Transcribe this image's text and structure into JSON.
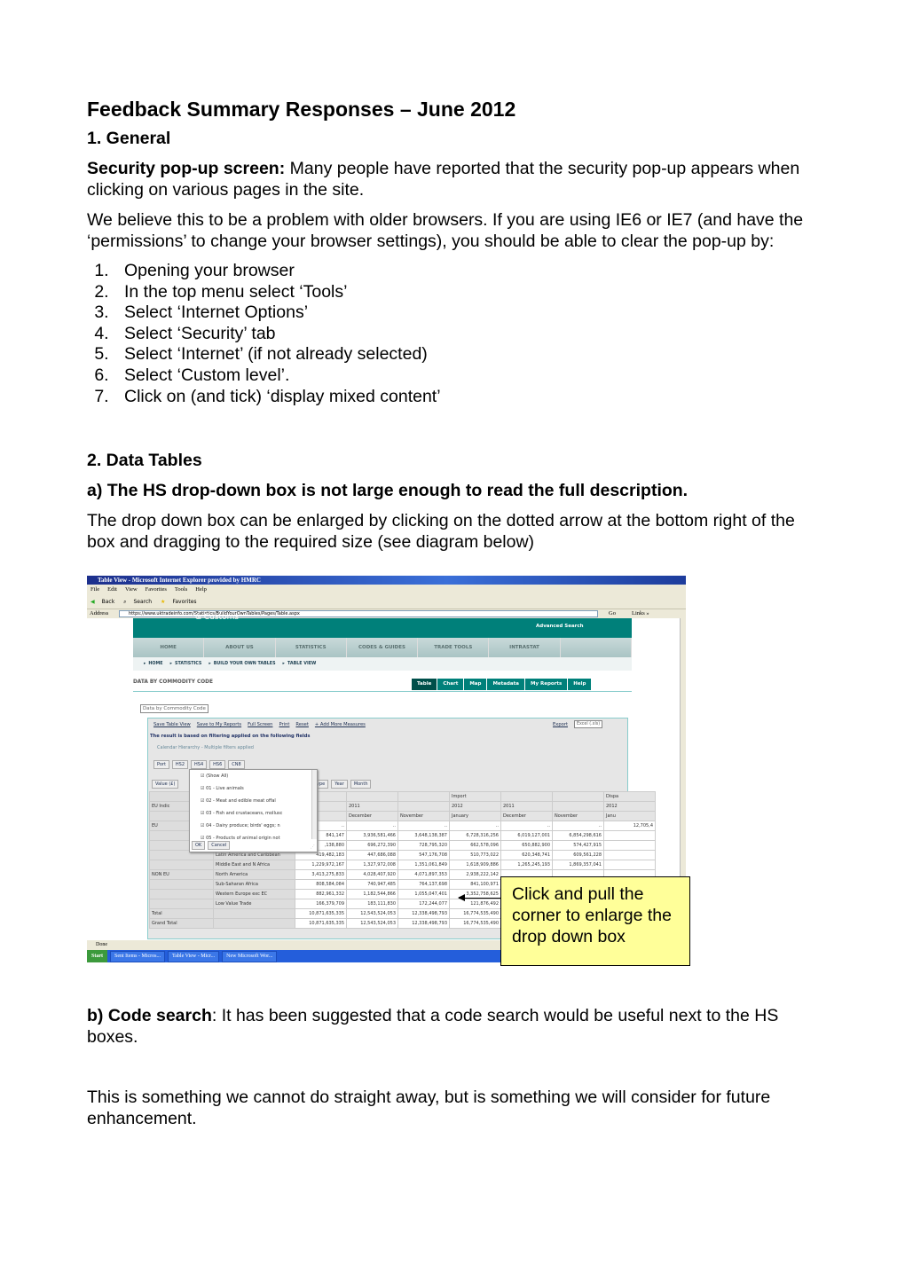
{
  "doc": {
    "title": "Feedback Summary Responses – June 2012",
    "s1_heading": "1. General",
    "p1_bold": "Security pop-up screen:",
    "p1_text": "  Many people have reported that the security pop-up appears when clicking on various pages in the site.",
    "p2": "We believe this to be a problem with older browsers. If you are using IE6 or IE7 (and have the ‘permissions’ to change your browser settings), you should be able to clear the pop-up by:",
    "steps": [
      "Opening your browser",
      "In the top menu select ‘Tools’",
      "Select ‘Internet Options’",
      "Select ‘Security’ tab",
      "Select ‘Internet’ (if not already selected)",
      "Select ‘Custom level’.",
      "Click on (and tick) ‘display mixed content’"
    ],
    "s2_heading": "2. Data Tables",
    "a_heading": "a) The HS drop-down box is not large enough to read the full description.",
    "a_text": "The drop down box can be enlarged by clicking on the dotted arrow at the bottom right of the box and dragging to the required size (see diagram below)",
    "b_bold": "b) Code search",
    "b_text": ":  It has been suggested that a code search would be useful next to the HS boxes.",
    "b_text2": "This is something we cannot do straight away, but is something we will consider for future enhancement."
  },
  "callout": "Click and pull the corner to enlarge the drop down box",
  "screenshot": {
    "window_title": "Table View - Microsoft Internet Explorer provided by HMRC",
    "menu": [
      "File",
      "Edit",
      "View",
      "Favorites",
      "Tools",
      "Help"
    ],
    "toolbar": [
      "Back",
      "Search",
      "Favorites"
    ],
    "address_label": "Address",
    "url": "https://www.uktradeinfo.com/Statistics/BuildYourOwnTables/Pages/Table.aspx",
    "go": "Go",
    "links": "Links »",
    "banner_logo": "& Customs",
    "advanced_search": "Advanced Search",
    "nav": [
      "HOME",
      "ABOUT US",
      "STATISTICS",
      "CODES & GUIDES",
      "TRADE TOOLS",
      "INTRASTAT",
      ""
    ],
    "breadcrumb": [
      "HOME",
      "STATISTICS",
      "BUILD YOUR OWN TABLES",
      "TABLE VIEW"
    ],
    "section_title": "DATA BY COMMODITY CODE",
    "tabs": [
      "Table",
      "Chart",
      "Map",
      "Metadata",
      "My Reports",
      "Help"
    ],
    "dataset_select": "Data by Commodity Code",
    "panel_actions": [
      "Save Table View",
      "Save to My Reports",
      "Full Screen",
      "Print",
      "Reset",
      "+ Add More Measures"
    ],
    "export": "Export",
    "export_format": "Excel (.xls)",
    "filter_note": "The result is based on filtering applied on the following fields",
    "filter_item": "Calendar Hierarchy - Multiple filters applied",
    "dims": [
      "Port",
      "HS2",
      "HS4",
      "HS6",
      "CN8"
    ],
    "measure": "Value (£)",
    "col_dims": [
      "ype",
      "Year",
      "Month"
    ],
    "popup_items": [
      "(Show All)",
      "01 - Live animals",
      "02 - Meat and edible meat offal",
      "03 - Fish and crustaceans, mollusc",
      "04 - Dairy produce; birds' eggs; n",
      "05 - Products of animal origin not"
    ],
    "popup_ok": "OK",
    "popup_cancel": "Cancel",
    "hdr1": [
      "ort",
      "",
      "",
      "Import",
      "",
      "",
      "Dispa"
    ],
    "hdr2": [
      "2",
      "2011",
      "",
      "2012",
      "2011",
      "",
      "2012"
    ],
    "hdr3": [
      "uary",
      "December",
      "November",
      "January",
      "December",
      "November",
      "Janu"
    ],
    "row_dim": "EU Indic",
    "rows": [
      {
        "g": "EU",
        "s": "",
        "v": [
          "..",
          "..",
          "..",
          "..",
          "..",
          "..",
          "12,705,4"
        ]
      },
      {
        "g": "",
        "s": "",
        "v": [
          "841,147",
          "3,936,581,466",
          "3,648,138,387",
          "6,728,316,256",
          "6,019,127,001",
          "6,854,298,616",
          ""
        ]
      },
      {
        "g": "",
        "s": "",
        "v": [
          ",138,880",
          "696,272,390",
          "728,795,320",
          "662,578,096",
          "650,882,900",
          "574,427,915",
          ""
        ]
      },
      {
        "g": "",
        "s": "Latin America and Caribbean",
        "v": [
          "419,482,183",
          "447,686,088",
          "547,176,708",
          "510,773,022",
          "620,348,741",
          "609,561,228",
          ""
        ]
      },
      {
        "g": "",
        "s": "Middle East and N Africa",
        "v": [
          "1,229,972,167",
          "1,327,972,008",
          "1,351,061,849",
          "1,618,909,886",
          "1,265,245,193",
          "1,869,357,041",
          ""
        ]
      },
      {
        "g": "NON EU",
        "s": "North America",
        "v": [
          "3,413,275,833",
          "4,028,407,920",
          "4,071,897,353",
          "2,938,222,142",
          "",
          "",
          ""
        ]
      },
      {
        "g": "",
        "s": "Sub-Saharan Africa",
        "v": [
          "808,584,084",
          "740,947,485",
          "764,137,698",
          "841,100,971",
          "",
          "",
          ""
        ]
      },
      {
        "g": "",
        "s": "Western Europe exc EC",
        "v": [
          "882,961,332",
          "1,182,544,866",
          "1,055,047,401",
          "3,352,758,625",
          "",
          "",
          ""
        ]
      },
      {
        "g": "",
        "s": "Low Value Trade",
        "v": [
          "166,379,709",
          "183,111,830",
          "172,244,077",
          "121,876,492",
          "",
          "",
          ""
        ]
      },
      {
        "g": "Total",
        "s": "",
        "v": [
          "10,871,635,335",
          "12,543,524,053",
          "12,338,498,793",
          "16,774,535,490",
          "",
          "",
          ""
        ]
      },
      {
        "g": "Grand Total",
        "s": "",
        "v": [
          "10,871,635,335",
          "12,543,524,053",
          "12,338,498,793",
          "16,774,535,490",
          "",
          "",
          ""
        ]
      }
    ],
    "status": "Done",
    "start": "Start",
    "taskbar": [
      "Sent Items - Micros...",
      "Table View - Micr...",
      "New Microsoft Wor..."
    ]
  }
}
